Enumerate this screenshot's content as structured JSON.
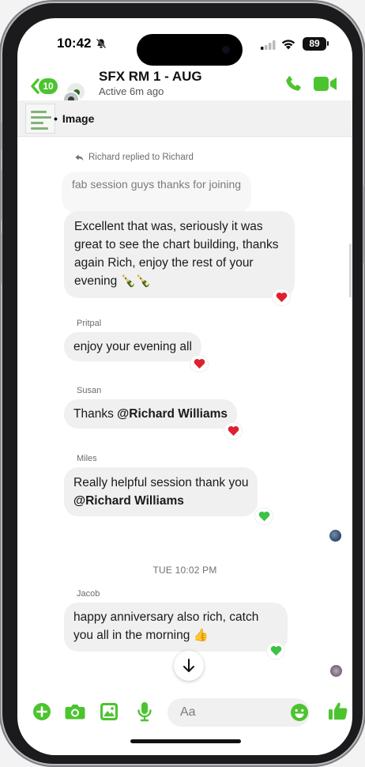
{
  "status_bar": {
    "time": "10:42",
    "battery": "89"
  },
  "header": {
    "back_count": "10",
    "title": "SFX RM 1 - AUG",
    "status": "Active 6m ago"
  },
  "pinned": {
    "label": "Image"
  },
  "messages": {
    "reply_note": "Richard replied to Richard",
    "quoted_text": "fab session guys thanks for joining",
    "richard_reply": "Excellent that was, seriously it was great to see the chart building, thanks again Rich, enjoy the rest of your evening 🍾🍾",
    "pritpal": {
      "sender": "Pritpal",
      "text": "enjoy your evening all"
    },
    "susan": {
      "sender": "Susan",
      "text": "Thanks ",
      "mention": "@Richard Williams"
    },
    "miles": {
      "sender": "Miles",
      "text": "Really helpful session thank you",
      "mention": "@Richard Williams"
    },
    "timestamp": "TUE 10:02 PM",
    "jacob": {
      "sender": "Jacob",
      "text": "happy anniversary also rich, catch you all in the morning 👍"
    }
  },
  "composer": {
    "placeholder": "Aa"
  },
  "colors": {
    "accent": "#4cc42f",
    "heart": "#e0202e",
    "green_heart": "#3cc245"
  },
  "icons": [
    "bell-slash-icon",
    "signal-icon",
    "wifi-icon",
    "battery-icon",
    "back-chevron-icon",
    "phone-icon",
    "video-icon",
    "reply-arrow-icon",
    "red-heart-icon",
    "green-heart-icon",
    "arrow-down-icon",
    "plus-icon",
    "camera-icon",
    "gallery-icon",
    "microphone-icon",
    "emoji-icon",
    "thumbs-up-icon"
  ]
}
